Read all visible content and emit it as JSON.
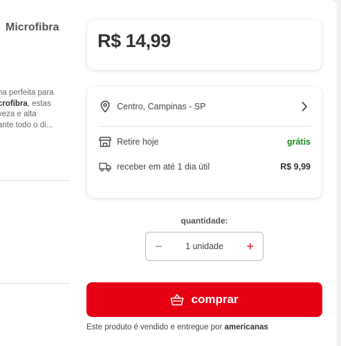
{
  "product": {
    "title": "Microfibra",
    "description_lines": [
      "na perfeita para",
      "crofibra",
      ", estas",
      "veza e alta",
      "ante todo o di..."
    ]
  },
  "price": {
    "value": "R$ 14,99"
  },
  "shipping": {
    "location": "Centro, Campinas - SP",
    "pickup_label": "Retire hoje",
    "pickup_value": "grátis",
    "delivery_label": "receber em até 1 dia útil",
    "delivery_value": "R$ 9,99",
    "icons": [
      "location-pin-icon",
      "chevron-right-icon",
      "store-icon",
      "truck-icon"
    ]
  },
  "quantity": {
    "label": "quantidade:",
    "value": "1 unidade",
    "minus": "−",
    "plus": "+"
  },
  "buy_button": {
    "label": "comprar",
    "icon": "basket-icon"
  },
  "seller": {
    "prefix": "Este produto é vendido e entregue por ",
    "name": "americanas"
  },
  "colors": {
    "accent": "#e60014",
    "free": "#1a8a1a",
    "text": "#333333"
  }
}
